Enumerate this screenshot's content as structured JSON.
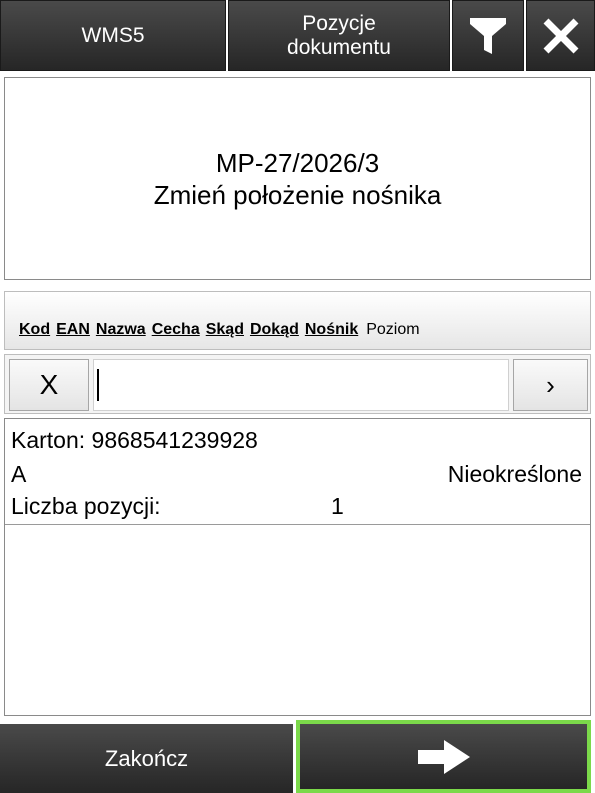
{
  "topbar": {
    "app_label": "WMS5",
    "title_line1": "Pozycje",
    "title_line2": "dokumentu",
    "filter_icon": "filter-icon",
    "close_icon": "close-icon"
  },
  "info": {
    "doc_number": "MP-27/2026/3",
    "operation": "Zmień położenie nośnika"
  },
  "columns": {
    "links": [
      "Kod",
      "EAN",
      "Nazwa",
      "Cecha",
      "Skąd",
      "Dokąd",
      "Nośnik"
    ],
    "plain": "Poziom"
  },
  "search": {
    "clear_label": "X",
    "value": "",
    "next_label": "›"
  },
  "list": {
    "items": [
      {
        "carrier": "Karton: 9868541239928",
        "code": "A",
        "status": "Nieokreślone",
        "count_label": "Liczba pozycji:",
        "count_value": "1"
      }
    ]
  },
  "bottombar": {
    "finish_label": "Zakończ",
    "next_icon": "arrow-right-icon"
  },
  "colors": {
    "button_dark": "#333333",
    "highlight": "#7bd94a"
  }
}
